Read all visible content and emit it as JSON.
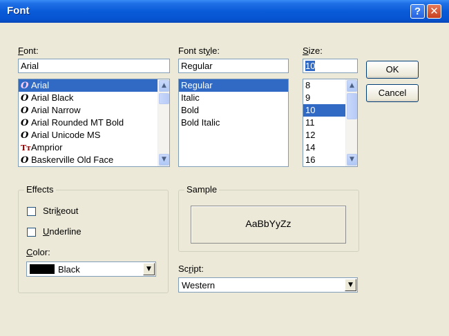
{
  "dialog": {
    "title": "Font",
    "help_glyph": "?",
    "close_glyph": "✕"
  },
  "font": {
    "label": "Font:",
    "value": "Arial",
    "items": [
      {
        "name": "Arial",
        "icon": "O",
        "icon_name": "opentype-icon",
        "selected": true
      },
      {
        "name": "Arial Black",
        "icon": "O",
        "icon_name": "opentype-icon"
      },
      {
        "name": "Arial Narrow",
        "icon": "O",
        "icon_name": "opentype-icon"
      },
      {
        "name": "Arial Rounded MT Bold",
        "icon": "O",
        "icon_name": "opentype-icon"
      },
      {
        "name": "Arial Unicode MS",
        "icon": "O",
        "icon_name": "opentype-icon"
      },
      {
        "name": "Amprior",
        "icon": "Tт",
        "icon_name": "truetype-icon"
      },
      {
        "name": "Baskerville Old Face",
        "icon": "O",
        "icon_name": "opentype-icon"
      }
    ]
  },
  "style": {
    "label": "Font style:",
    "value": "Regular",
    "items": [
      "Regular",
      "Italic",
      "Bold",
      "Bold Italic"
    ],
    "selected": "Regular"
  },
  "size": {
    "label": "Size:",
    "value": "10",
    "items": [
      "8",
      "9",
      "10",
      "11",
      "12",
      "14",
      "16"
    ],
    "selected": "10"
  },
  "buttons": {
    "ok": "OK",
    "cancel": "Cancel"
  },
  "effects": {
    "title": "Effects",
    "strikeout": "Strikeout",
    "underline": "Underline",
    "color_label": "Color:",
    "color_value": "Black",
    "color_swatch": "#000000"
  },
  "sample": {
    "title": "Sample",
    "text": "AaBbYyZz"
  },
  "script": {
    "label": "Script:",
    "value": "Western"
  },
  "colors": {
    "selection": "#316ac5",
    "titlebar": "#0a5bd8",
    "face": "#ece9d8"
  }
}
